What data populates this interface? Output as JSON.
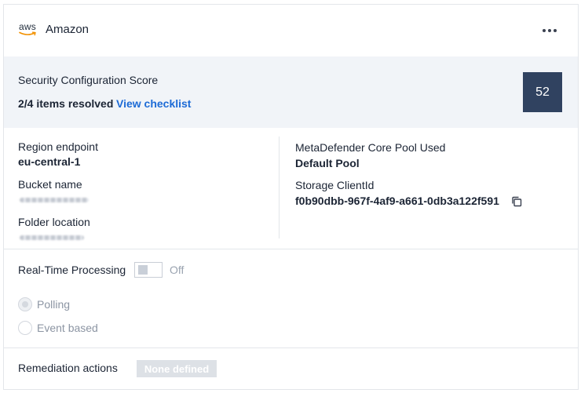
{
  "provider": {
    "logo_text": "aws",
    "name": "Amazon",
    "logo_icon": "aws-logo-icon",
    "more_icon": "more-horizontal-icon"
  },
  "score": {
    "title": "Security Configuration Score",
    "resolved": "2/4 items resolved",
    "checklist_link": "View checklist",
    "value": "52",
    "badge_color": "#304260",
    "link_color": "#1d6bd6"
  },
  "details": {
    "region_label": "Region endpoint",
    "region_value": "eu-central-1",
    "bucket_label": "Bucket name",
    "folder_label": "Folder location",
    "pool_label": "MetaDefender Core Pool Used",
    "pool_value": "Default Pool",
    "client_label": "Storage ClientId",
    "client_value": "f0b90dbb-967f-4af9-a661-0db3a122f591",
    "copy_icon": "copy-icon"
  },
  "processing": {
    "label": "Real-Time Processing",
    "toggle_state": "Off",
    "options": [
      {
        "label": "Polling",
        "checked": true
      },
      {
        "label": "Event based",
        "checked": false
      }
    ]
  },
  "remediation": {
    "label": "Remediation actions",
    "badge": "None defined"
  }
}
